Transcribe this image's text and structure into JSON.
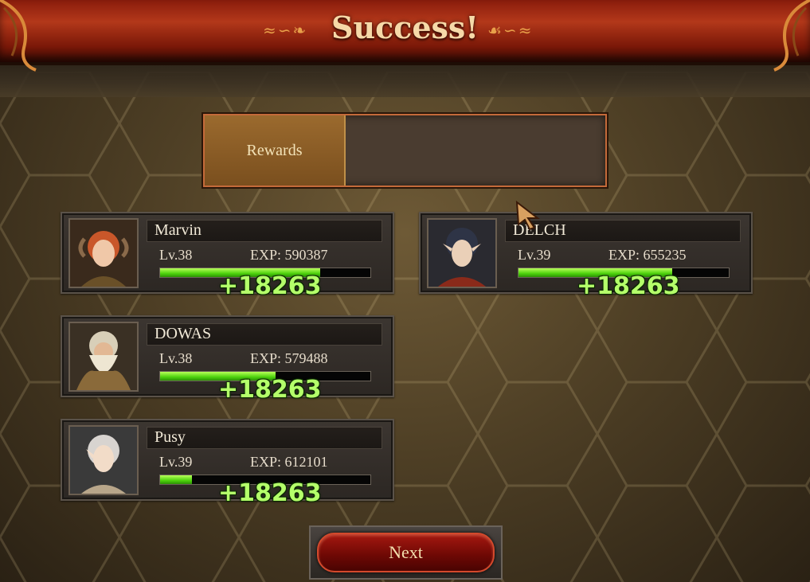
{
  "header": {
    "title": "Success!"
  },
  "rewards": {
    "label": "Rewards"
  },
  "characters": [
    {
      "name": "Marvin",
      "level": "Lv.38",
      "exp": "EXP: 590387",
      "exp_fill": 0.76,
      "gain": "+18263",
      "portrait": "horned-girl-portrait"
    },
    {
      "name": "DELCH",
      "level": "Lv.39",
      "exp": "EXP: 655235",
      "exp_fill": 0.73,
      "gain": "+18263",
      "portrait": "elf-boy-portrait"
    },
    {
      "name": "DOWAS",
      "level": "Lv.38",
      "exp": "EXP: 579488",
      "exp_fill": 0.55,
      "gain": "+18263",
      "portrait": "dwarf-portrait"
    },
    {
      "name": "Pusy",
      "level": "Lv.39",
      "exp": "EXP: 612101",
      "exp_fill": 0.15,
      "gain": "+18263",
      "portrait": "white-hair-elf-portrait"
    }
  ],
  "footer": {
    "next_label": "Next"
  },
  "colors": {
    "banner": "#b3381a",
    "exp_bar": "#4cd10c",
    "gain_text": "#b4ff6a",
    "next_button": "#a51810"
  }
}
